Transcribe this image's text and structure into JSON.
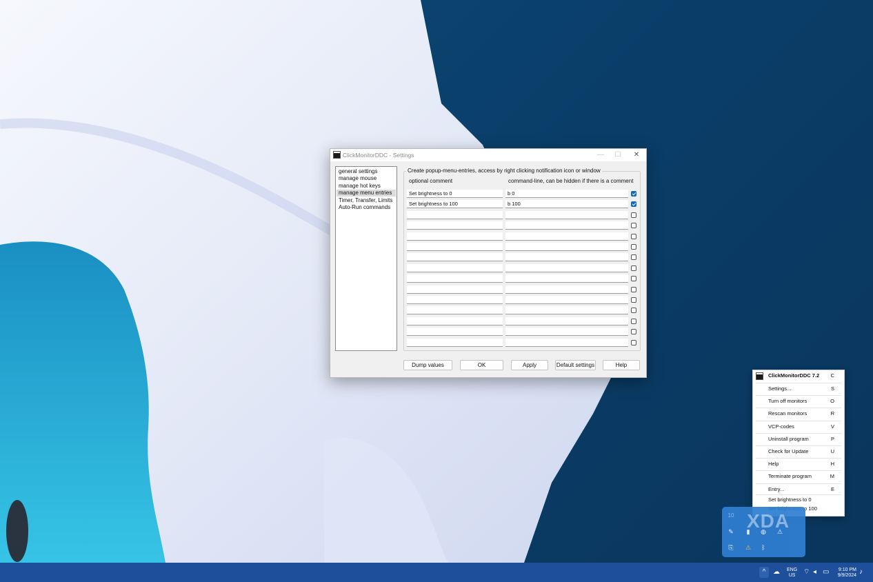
{
  "settings_window": {
    "title": "ClickMonitorDDC - Settings",
    "titlebar_buttons": {
      "minimize": "—",
      "maximize": "☐",
      "close": "✕"
    },
    "nav_items": [
      {
        "label": "general settings",
        "selected": false
      },
      {
        "label": "manage mouse",
        "selected": false
      },
      {
        "label": "manage hot keys",
        "selected": false
      },
      {
        "label": "manage menu entries",
        "selected": true
      },
      {
        "label": "Timer, Transfer, Limits",
        "selected": false
      },
      {
        "label": "Auto-Run commands",
        "selected": false
      }
    ],
    "group_title": "Create popup-menu-entries, access by right clicking notification icon or window",
    "column_headers": {
      "comment": "optional comment",
      "command": "command-line, can be hidden if there is a comment"
    },
    "entries": [
      {
        "comment": "Set brightness to 0",
        "command": "b 0",
        "checked": true
      },
      {
        "comment": "Set brightness to 100",
        "command": "b 100",
        "checked": true
      },
      {
        "comment": "",
        "command": "",
        "checked": false
      },
      {
        "comment": "",
        "command": "",
        "checked": false
      },
      {
        "comment": "",
        "command": "",
        "checked": false
      },
      {
        "comment": "",
        "command": "",
        "checked": false
      },
      {
        "comment": "",
        "command": "",
        "checked": false
      },
      {
        "comment": "",
        "command": "",
        "checked": false
      },
      {
        "comment": "",
        "command": "",
        "checked": false
      },
      {
        "comment": "",
        "command": "",
        "checked": false
      },
      {
        "comment": "",
        "command": "",
        "checked": false
      },
      {
        "comment": "",
        "command": "",
        "checked": false
      },
      {
        "comment": "",
        "command": "",
        "checked": false
      },
      {
        "comment": "",
        "command": "",
        "checked": false
      },
      {
        "comment": "",
        "command": "",
        "checked": false
      }
    ],
    "buttons": {
      "dump": "Dump values",
      "ok": "OK",
      "apply": "Apply",
      "defaults": "Default settings",
      "help": "Help"
    }
  },
  "context_menu": {
    "header": {
      "label": "ClickMonitorDDC 7.2",
      "key": "C"
    },
    "items": [
      {
        "label": "Settings...",
        "key": "S"
      },
      {
        "label": "Turn off monitors",
        "key": "O"
      },
      {
        "label": "Rescan monitors",
        "key": "R"
      },
      {
        "label": "VCP-codes",
        "key": "V"
      },
      {
        "label": "Uninstall program",
        "key": "P"
      },
      {
        "label": "Check for Update",
        "key": "U"
      },
      {
        "label": "Help",
        "key": "H"
      },
      {
        "label": "Terminate program",
        "key": "M"
      },
      {
        "label": "Entry...",
        "key": "E"
      }
    ],
    "custom_entries": [
      "Set brightness to 0",
      "Set brightness to 100"
    ]
  },
  "tray_overflow": {
    "brightness_value": "10",
    "icons": [
      "clickmonitor-icon",
      "paint-icon",
      "file-icon",
      "shield-icon",
      "warning-icon",
      "usb-icon",
      "defender-warning-icon",
      "bluetooth-icon"
    ]
  },
  "watermark": "XDA",
  "taskbar": {
    "chevron": "^",
    "language": "ENG",
    "region": "US",
    "time": "9:10 PM",
    "date": "9/9/2024"
  }
}
